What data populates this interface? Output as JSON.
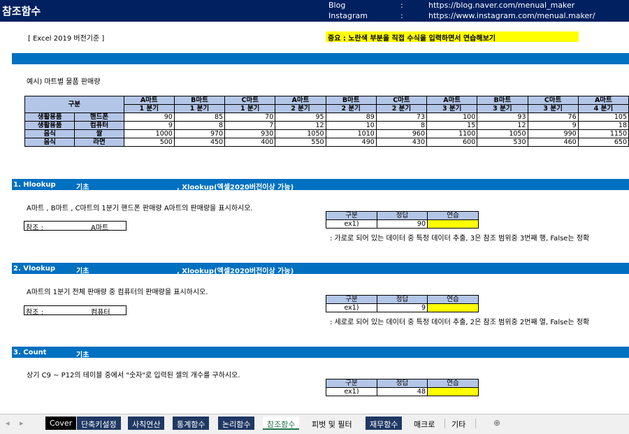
{
  "header": {
    "title": "참조함수",
    "links": [
      {
        "label": "Blog",
        "sep": ":",
        "url": "https://blog.naver.com/menual_maker"
      },
      {
        "label": "Instagram",
        "sep": ":",
        "url": "https://www.instagram.com/menual.maker/"
      }
    ]
  },
  "version_note": "[ Excel 2019 버전기준 ]",
  "important_note": "중요 : 노란색 부분을 직접 수식을 입력하면서 연습해보기",
  "example_title": "예시) 마트별 물품 판매량",
  "main_table": {
    "corner": "구분",
    "columns": [
      {
        "mart": "A마트",
        "quarter": "1 분기"
      },
      {
        "mart": "B마트",
        "quarter": "1 분기"
      },
      {
        "mart": "C마트",
        "quarter": "1 분기"
      },
      {
        "mart": "A마트",
        "quarter": "2 분기"
      },
      {
        "mart": "B마트",
        "quarter": "2 분기"
      },
      {
        "mart": "C마트",
        "quarter": "2 분기"
      },
      {
        "mart": "A마트",
        "quarter": "3 분기"
      },
      {
        "mart": "B마트",
        "quarter": "3 분기"
      },
      {
        "mart": "C마트",
        "quarter": "3 분기"
      },
      {
        "mart": "A마트",
        "quarter": "4 분기"
      }
    ],
    "rows": [
      {
        "category": "생활용품",
        "item": "핸드폰",
        "values": [
          "90",
          "85",
          "70",
          "95",
          "89",
          "73",
          "100",
          "93",
          "76",
          "105"
        ]
      },
      {
        "category": "생활용품",
        "item": "컴퓨터",
        "values": [
          "9",
          "8",
          "7",
          "12",
          "10",
          "8",
          "15",
          "12",
          "9",
          "18"
        ]
      },
      {
        "category": "음식",
        "item": "쌀",
        "values": [
          "1000",
          "970",
          "930",
          "1050",
          "1010",
          "960",
          "1100",
          "1050",
          "990",
          "1150"
        ]
      },
      {
        "category": "음식",
        "item": "라면",
        "values": [
          "500",
          "450",
          "400",
          "550",
          "490",
          "430",
          "600",
          "530",
          "460",
          "650"
        ]
      }
    ]
  },
  "sections": [
    {
      "title": "1. Hlookup",
      "level": "기초",
      "extra": ", Xlookup(엑셀2020버전이상 가능)",
      "question": "A마트 , B마트 , C마트의 1분기 핸드폰 판매량 A마트의 판매량을 표시하시오.",
      "ref_label": "참조 :",
      "ref_value": "A마트",
      "table": {
        "headers": [
          "구분",
          "정답",
          "연습"
        ],
        "row": [
          "ex1)",
          "90",
          ""
        ]
      },
      "note": ": 가로로 되어 있는 데이터 중 특정 데이터 추출, 3은 참조 범위중 3번째 행, False는 정확"
    },
    {
      "title": "2. Vlookup",
      "level": "기초",
      "extra": ", Xlookup(엑셀2020버전이상 가능)",
      "question": "A마트의 1분기 전체 판매량 중 컴퓨터의 판매량을 표시하시오.",
      "ref_label": "참조 :",
      "ref_value": "컴퓨터",
      "table": {
        "headers": [
          "구분",
          "정답",
          "연습"
        ],
        "row": [
          "ex1)",
          "9",
          ""
        ]
      },
      "note": ": 세로로 되어 있는 데이터 중 특정 데이터 추출, 2은 참조 범위중 2번째 열, False는 정확"
    },
    {
      "title": "3. Count",
      "level": "기초",
      "extra": "",
      "question": "상기 C9 ~ P12의 테이블 중에서 \"숫자\"로 입력된 셀의 개수를 구하시오.",
      "table": {
        "headers": [
          "구분",
          "정답",
          "연습"
        ],
        "row": [
          "ex1)",
          "48",
          ""
        ]
      }
    }
  ],
  "tabs": [
    "Cover",
    "단축키설정",
    "사칙연산",
    "통계함수",
    "논리함수",
    "참조함수",
    "피벗 및 필터",
    "재무함수",
    "매크로",
    "기타"
  ],
  "add_sheet": "⊕",
  "nav": [
    "◂",
    "▸"
  ],
  "colors": {
    "header": "#002060",
    "section_bar": "#0070C0",
    "table_header": "#B4C6E7",
    "highlight": "#FFFF00",
    "active_tab": "#217346"
  }
}
